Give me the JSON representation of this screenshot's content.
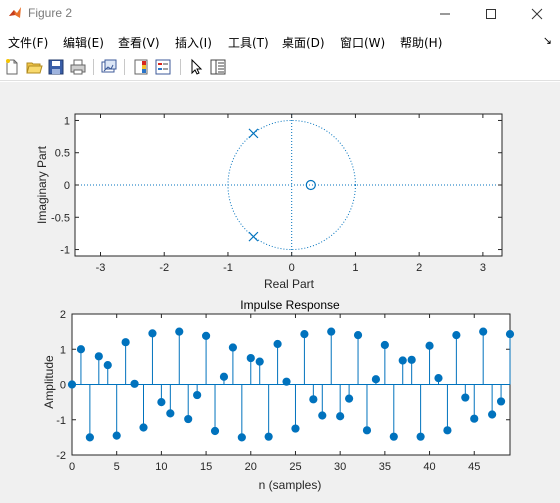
{
  "window": {
    "title": "Figure 2"
  },
  "menu": {
    "items": [
      "文件(F)",
      "编辑(E)",
      "查看(V)",
      "插入(I)",
      "工具(T)",
      "桌面(D)",
      "窗口(W)",
      "帮助(H)"
    ]
  },
  "toolbar": {
    "buttons": [
      "new-figure",
      "open-file",
      "save-figure",
      "print-figure",
      "link-plot",
      "insert-colorbar",
      "insert-legend",
      "edit-plot",
      "property-inspector"
    ]
  },
  "colors": {
    "accent": "#0072bd",
    "axes": "#262626",
    "figure_bg": "#f0f0f0"
  },
  "chart_data": [
    {
      "type": "scatter",
      "title": "",
      "xlabel": "Real Part",
      "ylabel": "Imaginary Part",
      "xlim": [
        -3.4,
        3.3
      ],
      "ylim": [
        -1.1,
        1.1
      ],
      "xticks": [
        -3,
        -2,
        -1,
        0,
        1,
        2,
        3
      ],
      "yticks": [
        -1,
        -0.5,
        0,
        0.5,
        1
      ],
      "unit_circle": true,
      "zeros": [
        {
          "x": 0.3,
          "y": 0
        }
      ],
      "poles": [
        {
          "x": -0.6,
          "y": 0.8
        },
        {
          "x": -0.6,
          "y": -0.8
        }
      ]
    },
    {
      "type": "stem",
      "title": "Impulse Response",
      "xlabel": "n (samples)",
      "ylabel": "Amplitude",
      "xlim": [
        0,
        49
      ],
      "ylim": [
        -2,
        2
      ],
      "xticks": [
        0,
        5,
        10,
        15,
        20,
        25,
        30,
        35,
        40,
        45
      ],
      "yticks": [
        -2,
        -1,
        0,
        1,
        2
      ],
      "x": [
        0,
        1,
        2,
        3,
        4,
        5,
        6,
        7,
        8,
        9,
        10,
        11,
        12,
        13,
        14,
        15,
        16,
        17,
        18,
        19,
        20,
        21,
        22,
        23,
        24,
        25,
        26,
        27,
        28,
        29,
        30,
        31,
        32,
        33,
        34,
        35,
        36,
        37,
        38,
        39,
        40,
        41,
        42,
        43,
        44,
        45,
        46,
        47,
        48,
        49
      ],
      "values": [
        0,
        1.0,
        -1.5,
        0.8,
        0.55,
        -1.45,
        1.2,
        0.02,
        -1.22,
        1.45,
        -0.5,
        -0.82,
        1.5,
        -0.98,
        -0.3,
        1.38,
        -1.32,
        0.22,
        1.05,
        -1.5,
        0.75,
        0.65,
        -1.48,
        1.15,
        0.08,
        -1.25,
        1.43,
        -0.42,
        -0.88,
        1.5,
        -0.9,
        -0.4,
        1.4,
        -1.3,
        0.15,
        1.12,
        -1.48,
        0.68,
        0.7,
        -1.48,
        1.1,
        0.18,
        -1.3,
        1.4,
        -0.37,
        -0.97,
        1.5,
        -0.85,
        -0.48,
        1.43
      ]
    }
  ]
}
